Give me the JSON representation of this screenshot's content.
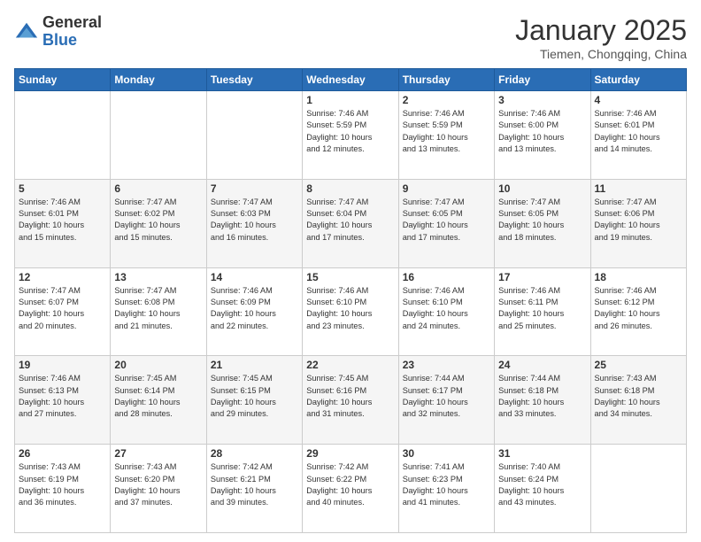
{
  "logo": {
    "general": "General",
    "blue": "Blue"
  },
  "header": {
    "month": "January 2025",
    "location": "Tiemen, Chongqing, China"
  },
  "weekdays": [
    "Sunday",
    "Monday",
    "Tuesday",
    "Wednesday",
    "Thursday",
    "Friday",
    "Saturday"
  ],
  "weeks": [
    [
      {
        "day": "",
        "info": ""
      },
      {
        "day": "",
        "info": ""
      },
      {
        "day": "",
        "info": ""
      },
      {
        "day": "1",
        "info": "Sunrise: 7:46 AM\nSunset: 5:59 PM\nDaylight: 10 hours\nand 12 minutes."
      },
      {
        "day": "2",
        "info": "Sunrise: 7:46 AM\nSunset: 5:59 PM\nDaylight: 10 hours\nand 13 minutes."
      },
      {
        "day": "3",
        "info": "Sunrise: 7:46 AM\nSunset: 6:00 PM\nDaylight: 10 hours\nand 13 minutes."
      },
      {
        "day": "4",
        "info": "Sunrise: 7:46 AM\nSunset: 6:01 PM\nDaylight: 10 hours\nand 14 minutes."
      }
    ],
    [
      {
        "day": "5",
        "info": "Sunrise: 7:46 AM\nSunset: 6:01 PM\nDaylight: 10 hours\nand 15 minutes."
      },
      {
        "day": "6",
        "info": "Sunrise: 7:47 AM\nSunset: 6:02 PM\nDaylight: 10 hours\nand 15 minutes."
      },
      {
        "day": "7",
        "info": "Sunrise: 7:47 AM\nSunset: 6:03 PM\nDaylight: 10 hours\nand 16 minutes."
      },
      {
        "day": "8",
        "info": "Sunrise: 7:47 AM\nSunset: 6:04 PM\nDaylight: 10 hours\nand 17 minutes."
      },
      {
        "day": "9",
        "info": "Sunrise: 7:47 AM\nSunset: 6:05 PM\nDaylight: 10 hours\nand 17 minutes."
      },
      {
        "day": "10",
        "info": "Sunrise: 7:47 AM\nSunset: 6:05 PM\nDaylight: 10 hours\nand 18 minutes."
      },
      {
        "day": "11",
        "info": "Sunrise: 7:47 AM\nSunset: 6:06 PM\nDaylight: 10 hours\nand 19 minutes."
      }
    ],
    [
      {
        "day": "12",
        "info": "Sunrise: 7:47 AM\nSunset: 6:07 PM\nDaylight: 10 hours\nand 20 minutes."
      },
      {
        "day": "13",
        "info": "Sunrise: 7:47 AM\nSunset: 6:08 PM\nDaylight: 10 hours\nand 21 minutes."
      },
      {
        "day": "14",
        "info": "Sunrise: 7:46 AM\nSunset: 6:09 PM\nDaylight: 10 hours\nand 22 minutes."
      },
      {
        "day": "15",
        "info": "Sunrise: 7:46 AM\nSunset: 6:10 PM\nDaylight: 10 hours\nand 23 minutes."
      },
      {
        "day": "16",
        "info": "Sunrise: 7:46 AM\nSunset: 6:10 PM\nDaylight: 10 hours\nand 24 minutes."
      },
      {
        "day": "17",
        "info": "Sunrise: 7:46 AM\nSunset: 6:11 PM\nDaylight: 10 hours\nand 25 minutes."
      },
      {
        "day": "18",
        "info": "Sunrise: 7:46 AM\nSunset: 6:12 PM\nDaylight: 10 hours\nand 26 minutes."
      }
    ],
    [
      {
        "day": "19",
        "info": "Sunrise: 7:46 AM\nSunset: 6:13 PM\nDaylight: 10 hours\nand 27 minutes."
      },
      {
        "day": "20",
        "info": "Sunrise: 7:45 AM\nSunset: 6:14 PM\nDaylight: 10 hours\nand 28 minutes."
      },
      {
        "day": "21",
        "info": "Sunrise: 7:45 AM\nSunset: 6:15 PM\nDaylight: 10 hours\nand 29 minutes."
      },
      {
        "day": "22",
        "info": "Sunrise: 7:45 AM\nSunset: 6:16 PM\nDaylight: 10 hours\nand 31 minutes."
      },
      {
        "day": "23",
        "info": "Sunrise: 7:44 AM\nSunset: 6:17 PM\nDaylight: 10 hours\nand 32 minutes."
      },
      {
        "day": "24",
        "info": "Sunrise: 7:44 AM\nSunset: 6:18 PM\nDaylight: 10 hours\nand 33 minutes."
      },
      {
        "day": "25",
        "info": "Sunrise: 7:43 AM\nSunset: 6:18 PM\nDaylight: 10 hours\nand 34 minutes."
      }
    ],
    [
      {
        "day": "26",
        "info": "Sunrise: 7:43 AM\nSunset: 6:19 PM\nDaylight: 10 hours\nand 36 minutes."
      },
      {
        "day": "27",
        "info": "Sunrise: 7:43 AM\nSunset: 6:20 PM\nDaylight: 10 hours\nand 37 minutes."
      },
      {
        "day": "28",
        "info": "Sunrise: 7:42 AM\nSunset: 6:21 PM\nDaylight: 10 hours\nand 39 minutes."
      },
      {
        "day": "29",
        "info": "Sunrise: 7:42 AM\nSunset: 6:22 PM\nDaylight: 10 hours\nand 40 minutes."
      },
      {
        "day": "30",
        "info": "Sunrise: 7:41 AM\nSunset: 6:23 PM\nDaylight: 10 hours\nand 41 minutes."
      },
      {
        "day": "31",
        "info": "Sunrise: 7:40 AM\nSunset: 6:24 PM\nDaylight: 10 hours\nand 43 minutes."
      },
      {
        "day": "",
        "info": ""
      }
    ]
  ]
}
